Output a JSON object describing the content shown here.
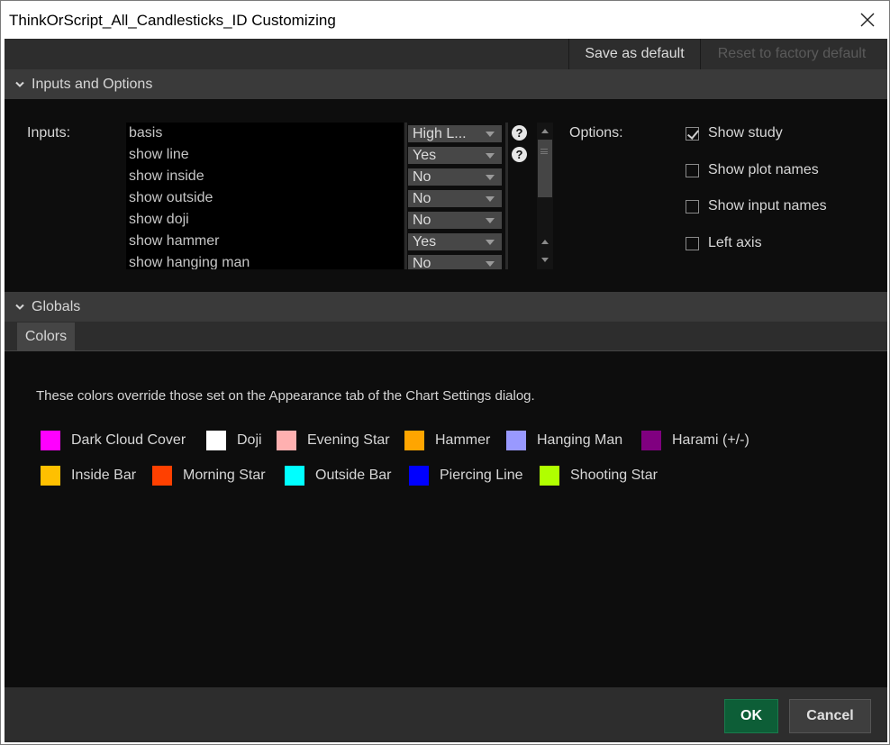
{
  "window": {
    "title": "ThinkOrScript_All_Candlesticks_ID Customizing",
    "close_icon": "close-icon"
  },
  "toolbar": {
    "save_default": "Save as default",
    "reset_default": "Reset to factory default"
  },
  "inputs_section": {
    "header": "Inputs and Options",
    "inputs_label": "Inputs:",
    "options_label": "Options:"
  },
  "inputs": [
    {
      "name": "basis",
      "value": "High L..."
    },
    {
      "name": "show line",
      "value": "Yes"
    },
    {
      "name": "show inside",
      "value": "No"
    },
    {
      "name": "show outside",
      "value": "No"
    },
    {
      "name": "show doji",
      "value": "No"
    },
    {
      "name": "show hammer",
      "value": "Yes"
    },
    {
      "name": "show hanging man",
      "value": "No"
    }
  ],
  "help_icon": "?",
  "options": [
    {
      "label": "Show study",
      "checked": true
    },
    {
      "label": "Show plot names",
      "checked": false
    },
    {
      "label": "Show input names",
      "checked": false
    },
    {
      "label": "Left axis",
      "checked": false
    }
  ],
  "globals_section": {
    "header": "Globals",
    "tab": "Colors"
  },
  "colors_description": "These colors override those set on the Appearance tab of the Chart Settings dialog.",
  "colors": [
    {
      "label": "Dark Cloud Cover",
      "color": "#ff00ff"
    },
    {
      "label": "Doji",
      "color": "#ffffff"
    },
    {
      "label": "Evening Star",
      "color": "#ffb0b0"
    },
    {
      "label": "Hammer",
      "color": "#ffa500"
    },
    {
      "label": "Hanging Man",
      "color": "#9999ff"
    },
    {
      "label": "Harami (+/-)",
      "color": "#800080"
    },
    {
      "label": "Inside Bar",
      "color": "#ffc000"
    },
    {
      "label": "Morning Star",
      "color": "#ff4000"
    },
    {
      "label": "Outside Bar",
      "color": "#00ffff"
    },
    {
      "label": "Piercing Line",
      "color": "#0000ff"
    },
    {
      "label": "Shooting Star",
      "color": "#b0ff00"
    }
  ],
  "footer": {
    "ok": "OK",
    "cancel": "Cancel"
  }
}
